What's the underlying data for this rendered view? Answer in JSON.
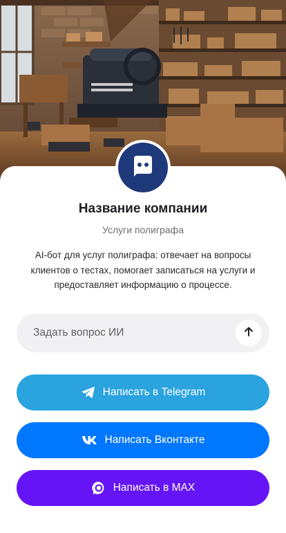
{
  "company": {
    "name": "Название компании",
    "subtitle": "Услуги полиграфа",
    "description": "AI-бот для услуг полиграфа: отвечает на вопросы клиентов о тестах, помогает записаться на услуги и предоставляет информацию о процессе."
  },
  "hero": {
    "icon": "workshop-photo"
  },
  "avatar": {
    "icon": "chat-bubble-icon",
    "color": "#1f3a7a"
  },
  "ask": {
    "placeholder": "Задать вопрос ИИ",
    "value": "",
    "send_icon": "arrow-up-icon"
  },
  "buttons": {
    "telegram": {
      "label": "Написать в Telegram",
      "icon": "telegram-icon",
      "color": "#2aa3df"
    },
    "vk": {
      "label": "Написать Вконтакте",
      "icon": "vk-icon",
      "color": "#0077ff"
    },
    "max": {
      "label": "Написать в MAX",
      "icon": "max-icon",
      "color": "#6515f5"
    }
  }
}
